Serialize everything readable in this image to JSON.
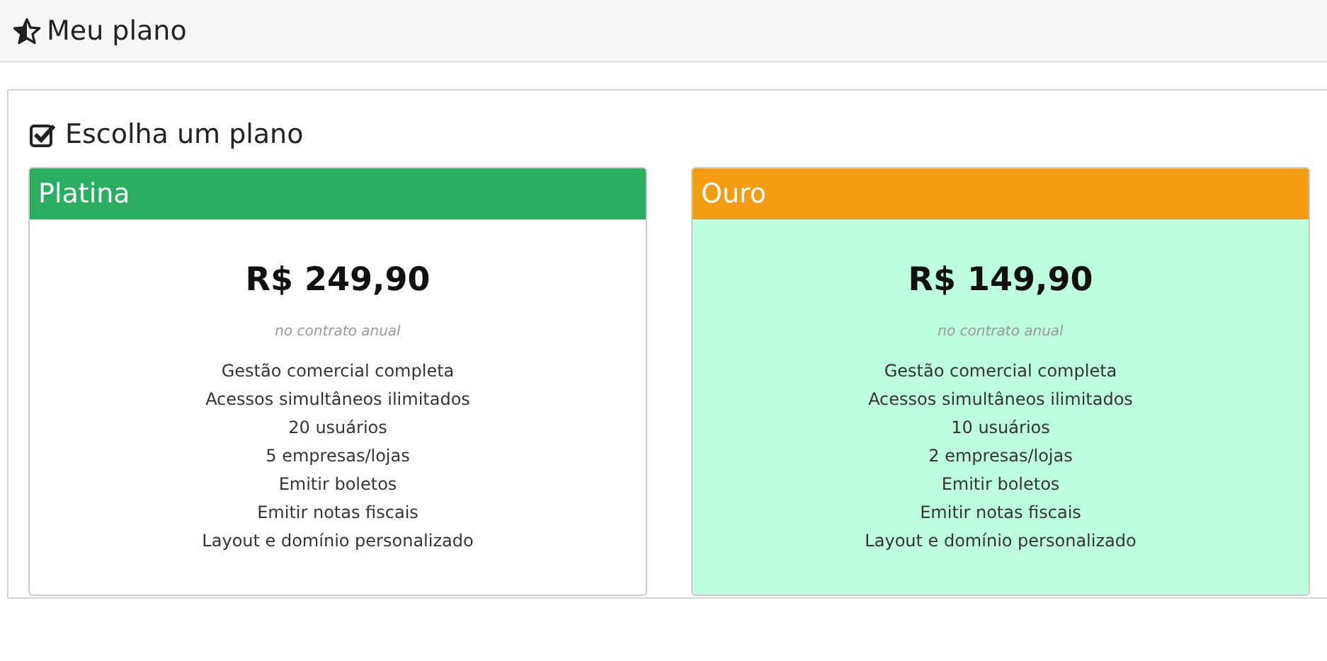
{
  "page_title": "Meu plano",
  "section_title": "Escolha um plano",
  "plans": [
    {
      "name": "Platina",
      "color": "#27ae60",
      "selected": false,
      "price": "R$ 249,90",
      "note": "no contrato anual",
      "features": [
        "Gestão comercial completa",
        "Acessos simultâneos ilimitados",
        "20 usuários",
        "5 empresas/lojas",
        "Emitir boletos",
        "Emitir notas fiscais",
        "Layout e domínio personalizado"
      ]
    },
    {
      "name": "Ouro",
      "color": "#f39c12",
      "selected": true,
      "price": "R$ 149,90",
      "note": "no contrato anual",
      "features": [
        "Gestão comercial completa",
        "Acessos simultâneos ilimitados",
        "10 usuários",
        "2 empresas/lojas",
        "Emitir boletos",
        "Emitir notas fiscais",
        "Layout e domínio personalizado"
      ]
    }
  ]
}
